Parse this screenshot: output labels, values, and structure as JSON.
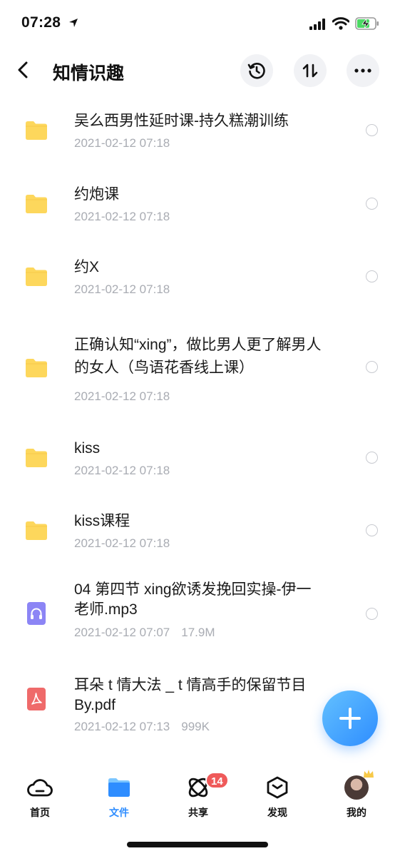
{
  "status_bar": {
    "time": "07:28"
  },
  "header": {
    "title": "知情识趣"
  },
  "files": [
    {
      "type": "folder",
      "name": "吴么西男性延时课-持久糕潮训练",
      "date": "2021-02-12 07:18",
      "size": ""
    },
    {
      "type": "folder",
      "name": "约炮课",
      "date": "2021-02-12 07:18",
      "size": ""
    },
    {
      "type": "folder",
      "name": "约X",
      "date": "2021-02-12 07:18",
      "size": ""
    },
    {
      "type": "folder",
      "name": "正确认知“xing”，做比男人更了解男人的女人（鸟语花香线上课）",
      "date": "2021-02-12 07:18",
      "size": ""
    },
    {
      "type": "folder",
      "name": "kiss",
      "date": "2021-02-12 07:18",
      "size": ""
    },
    {
      "type": "folder",
      "name": "kiss课程",
      "date": "2021-02-12 07:18",
      "size": ""
    },
    {
      "type": "audio",
      "name": "04 第四节 xing欲诱发挽回实操-伊一老师.mp3",
      "date": "2021-02-12 07:07",
      "size": "17.9M"
    },
    {
      "type": "pdf",
      "name": "耳朵 t 情大法 _ t 情高手的保留节目By.pdf",
      "date": "2021-02-12 07:13",
      "size": "999K"
    }
  ],
  "tabs": [
    {
      "label": "首页",
      "icon": "cloud-icon"
    },
    {
      "label": "文件",
      "icon": "folder-icon"
    },
    {
      "label": "共享",
      "icon": "orbit-icon",
      "badge": "14"
    },
    {
      "label": "发现",
      "icon": "cube-icon"
    },
    {
      "label": "我的",
      "icon": "avatar"
    }
  ],
  "colors": {
    "accent": "#2e8dff",
    "folder": "#fdd75c",
    "badge": "#ef5a5a",
    "meta": "#a9acb3"
  }
}
